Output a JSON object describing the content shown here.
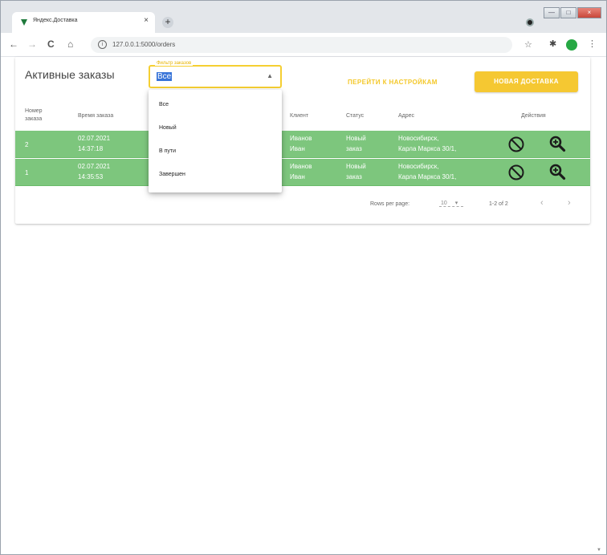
{
  "browser": {
    "tab_title": "Яндекс.Доставка",
    "tab_close": "×",
    "new_tab": "+",
    "url": "127.0.0.1:5000/orders",
    "back": "←",
    "forward": "→",
    "reload": "C",
    "home": "⌂",
    "info": "i",
    "star": "☆",
    "extensions": "✱",
    "menu": "⋮",
    "window_controls": {
      "minimize": "—",
      "maximize": "□",
      "close": "×"
    },
    "colors": {
      "favicon": "#1f7a3c",
      "profile": "#27a844"
    }
  },
  "header": {
    "title": "Активные заказы",
    "filter_label": "Фильтр заказов",
    "filter_value": "Все",
    "filter_arrow": "▲",
    "settings_link": "ПЕРЕЙТИ К НАСТРОЙКАМ",
    "new_delivery": "НОВАЯ ДОСТАВКА"
  },
  "table": {
    "headers": {
      "number_line1": "Номер",
      "number_line2": "заказа",
      "time": "Время заказа",
      "client": "Клиент",
      "status": "Статус",
      "address": "Адрес",
      "actions": "Действия"
    },
    "rows": [
      {
        "number": "2",
        "date": "02.07.2021",
        "time": "14:37:18",
        "client1": "Иванов",
        "client2": "Иван",
        "status1": "Новый",
        "status2": "заказ",
        "address1": "Новосибирск,",
        "address2": "Карла Маркса 30/1,"
      },
      {
        "number": "1",
        "date": "02.07.2021",
        "time": "14:35:53",
        "client1": "Иванов",
        "client2": "Иван",
        "status1": "Новый",
        "status2": "заказ",
        "address1": "Новосибирск,",
        "address2": "Карла Маркса 30/1,"
      }
    ],
    "row_color": "#7dc67d"
  },
  "footer": {
    "rows_per_page_label": "Rows per page:",
    "rows_per_page_value": "10",
    "rows_per_page_arrow": "▾",
    "range": "1-2 of 2",
    "prev": "‹",
    "next": "›"
  },
  "menu": {
    "items": [
      "Все",
      "Новый",
      "В пути",
      "Завершен"
    ]
  },
  "colors": {
    "accent": "#f5c832",
    "highlight": "#3874d8"
  }
}
